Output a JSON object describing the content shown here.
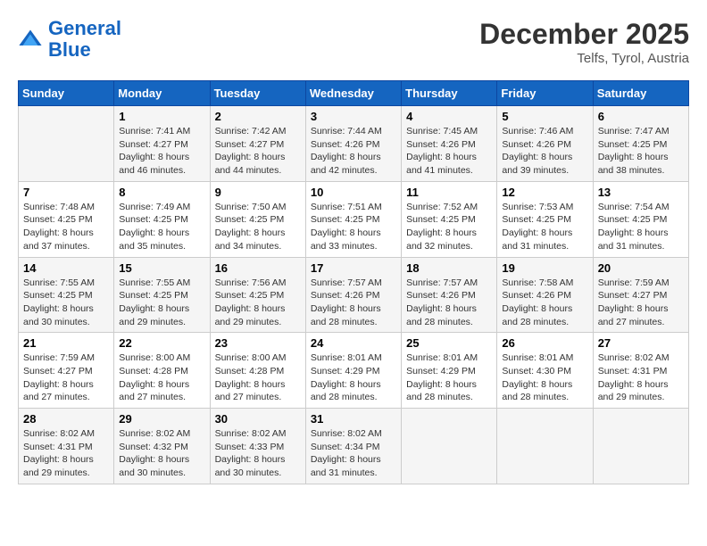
{
  "header": {
    "logo_line1": "General",
    "logo_line2": "Blue",
    "month_year": "December 2025",
    "location": "Telfs, Tyrol, Austria"
  },
  "days_of_week": [
    "Sunday",
    "Monday",
    "Tuesday",
    "Wednesday",
    "Thursday",
    "Friday",
    "Saturday"
  ],
  "weeks": [
    [
      {
        "day": "",
        "info": ""
      },
      {
        "day": "1",
        "info": "Sunrise: 7:41 AM\nSunset: 4:27 PM\nDaylight: 8 hours\nand 46 minutes."
      },
      {
        "day": "2",
        "info": "Sunrise: 7:42 AM\nSunset: 4:27 PM\nDaylight: 8 hours\nand 44 minutes."
      },
      {
        "day": "3",
        "info": "Sunrise: 7:44 AM\nSunset: 4:26 PM\nDaylight: 8 hours\nand 42 minutes."
      },
      {
        "day": "4",
        "info": "Sunrise: 7:45 AM\nSunset: 4:26 PM\nDaylight: 8 hours\nand 41 minutes."
      },
      {
        "day": "5",
        "info": "Sunrise: 7:46 AM\nSunset: 4:26 PM\nDaylight: 8 hours\nand 39 minutes."
      },
      {
        "day": "6",
        "info": "Sunrise: 7:47 AM\nSunset: 4:25 PM\nDaylight: 8 hours\nand 38 minutes."
      }
    ],
    [
      {
        "day": "7",
        "info": "Sunrise: 7:48 AM\nSunset: 4:25 PM\nDaylight: 8 hours\nand 37 minutes."
      },
      {
        "day": "8",
        "info": "Sunrise: 7:49 AM\nSunset: 4:25 PM\nDaylight: 8 hours\nand 35 minutes."
      },
      {
        "day": "9",
        "info": "Sunrise: 7:50 AM\nSunset: 4:25 PM\nDaylight: 8 hours\nand 34 minutes."
      },
      {
        "day": "10",
        "info": "Sunrise: 7:51 AM\nSunset: 4:25 PM\nDaylight: 8 hours\nand 33 minutes."
      },
      {
        "day": "11",
        "info": "Sunrise: 7:52 AM\nSunset: 4:25 PM\nDaylight: 8 hours\nand 32 minutes."
      },
      {
        "day": "12",
        "info": "Sunrise: 7:53 AM\nSunset: 4:25 PM\nDaylight: 8 hours\nand 31 minutes."
      },
      {
        "day": "13",
        "info": "Sunrise: 7:54 AM\nSunset: 4:25 PM\nDaylight: 8 hours\nand 31 minutes."
      }
    ],
    [
      {
        "day": "14",
        "info": "Sunrise: 7:55 AM\nSunset: 4:25 PM\nDaylight: 8 hours\nand 30 minutes."
      },
      {
        "day": "15",
        "info": "Sunrise: 7:55 AM\nSunset: 4:25 PM\nDaylight: 8 hours\nand 29 minutes."
      },
      {
        "day": "16",
        "info": "Sunrise: 7:56 AM\nSunset: 4:25 PM\nDaylight: 8 hours\nand 29 minutes."
      },
      {
        "day": "17",
        "info": "Sunrise: 7:57 AM\nSunset: 4:26 PM\nDaylight: 8 hours\nand 28 minutes."
      },
      {
        "day": "18",
        "info": "Sunrise: 7:57 AM\nSunset: 4:26 PM\nDaylight: 8 hours\nand 28 minutes."
      },
      {
        "day": "19",
        "info": "Sunrise: 7:58 AM\nSunset: 4:26 PM\nDaylight: 8 hours\nand 28 minutes."
      },
      {
        "day": "20",
        "info": "Sunrise: 7:59 AM\nSunset: 4:27 PM\nDaylight: 8 hours\nand 27 minutes."
      }
    ],
    [
      {
        "day": "21",
        "info": "Sunrise: 7:59 AM\nSunset: 4:27 PM\nDaylight: 8 hours\nand 27 minutes."
      },
      {
        "day": "22",
        "info": "Sunrise: 8:00 AM\nSunset: 4:28 PM\nDaylight: 8 hours\nand 27 minutes."
      },
      {
        "day": "23",
        "info": "Sunrise: 8:00 AM\nSunset: 4:28 PM\nDaylight: 8 hours\nand 27 minutes."
      },
      {
        "day": "24",
        "info": "Sunrise: 8:01 AM\nSunset: 4:29 PM\nDaylight: 8 hours\nand 28 minutes."
      },
      {
        "day": "25",
        "info": "Sunrise: 8:01 AM\nSunset: 4:29 PM\nDaylight: 8 hours\nand 28 minutes."
      },
      {
        "day": "26",
        "info": "Sunrise: 8:01 AM\nSunset: 4:30 PM\nDaylight: 8 hours\nand 28 minutes."
      },
      {
        "day": "27",
        "info": "Sunrise: 8:02 AM\nSunset: 4:31 PM\nDaylight: 8 hours\nand 29 minutes."
      }
    ],
    [
      {
        "day": "28",
        "info": "Sunrise: 8:02 AM\nSunset: 4:31 PM\nDaylight: 8 hours\nand 29 minutes."
      },
      {
        "day": "29",
        "info": "Sunrise: 8:02 AM\nSunset: 4:32 PM\nDaylight: 8 hours\nand 30 minutes."
      },
      {
        "day": "30",
        "info": "Sunrise: 8:02 AM\nSunset: 4:33 PM\nDaylight: 8 hours\nand 30 minutes."
      },
      {
        "day": "31",
        "info": "Sunrise: 8:02 AM\nSunset: 4:34 PM\nDaylight: 8 hours\nand 31 minutes."
      },
      {
        "day": "",
        "info": ""
      },
      {
        "day": "",
        "info": ""
      },
      {
        "day": "",
        "info": ""
      }
    ]
  ]
}
